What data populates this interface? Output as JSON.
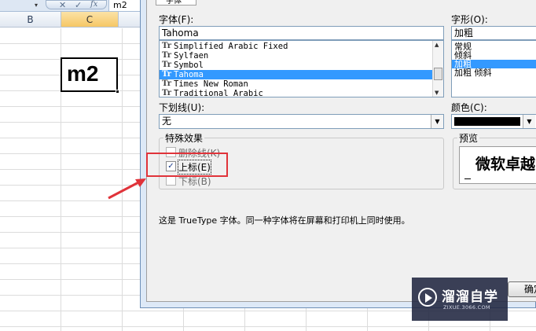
{
  "excel": {
    "formula_bar": {
      "name_box_dropdown": "▾",
      "cancel_icon": "✕",
      "enter_icon": "✓",
      "fx_label": "fx",
      "value": "m2"
    },
    "columns": [
      {
        "label": "B",
        "selected": false
      },
      {
        "label": "C",
        "selected": true
      }
    ],
    "active_cell": {
      "address": "C",
      "value": "m2"
    }
  },
  "dialog": {
    "tab_label": "字体",
    "font": {
      "label": "字体(F):",
      "value": "Tahoma",
      "list": [
        {
          "name": "Simplified Arabic Fixed",
          "selected": false
        },
        {
          "name": "Sylfaen",
          "selected": false
        },
        {
          "name": "Symbol",
          "selected": false
        },
        {
          "name": "Tahoma",
          "selected": true
        },
        {
          "name": "Times New Roman",
          "selected": false
        },
        {
          "name": "Traditional Arabic",
          "selected": false
        }
      ],
      "icon_glyph": "Tr"
    },
    "style": {
      "label": "字形(O):",
      "value": "加粗",
      "list": [
        {
          "name": "常规",
          "selected": false
        },
        {
          "name": "倾斜",
          "selected": false
        },
        {
          "name": "加粗",
          "selected": true
        },
        {
          "name": "加粗 倾斜",
          "selected": false
        }
      ]
    },
    "underline": {
      "label": "下划线(U):",
      "value": "无"
    },
    "color": {
      "label": "颜色(C):",
      "swatch": "#000000"
    },
    "effects": {
      "title": "特殊效果",
      "strikethrough": {
        "label": "删除线(K)",
        "checked": false
      },
      "superscript": {
        "label": "上标(E)",
        "checked": true
      },
      "subscript": {
        "label": "下标(B)",
        "checked": false
      }
    },
    "preview": {
      "title": "预览",
      "sample": "微软卓越"
    },
    "description": "这是 TrueType 字体。同一种字体将在屏幕和打印机上同时使用。",
    "ok_button": "确定"
  },
  "watermark": {
    "name": "溜溜自学",
    "url": "ZIXUE.3066.COM"
  },
  "colors": {
    "accent_red": "#e0333a",
    "selection_blue": "#3399ff"
  }
}
